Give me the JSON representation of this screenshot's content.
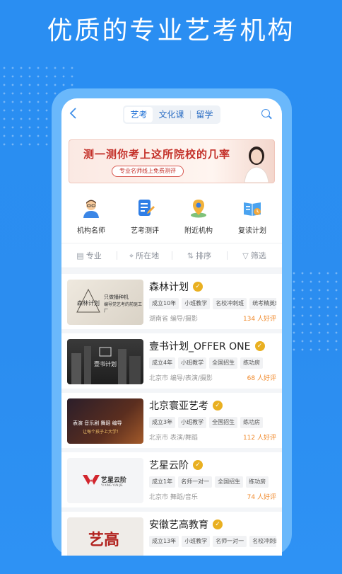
{
  "headline": "优质的专业艺考机构",
  "tabs": [
    {
      "label": "艺考",
      "active": true
    },
    {
      "label": "文化课",
      "active": false
    },
    {
      "label": "留学",
      "active": false
    }
  ],
  "banner": {
    "title": "测一测你考上这所院校的几率",
    "subtitle": "专业名师线上免费测评"
  },
  "categories": [
    {
      "label": "机构名师",
      "icon": "teacher-avatar-icon"
    },
    {
      "label": "艺考测评",
      "icon": "assessment-document-icon"
    },
    {
      "label": "附近机构",
      "icon": "nearby-map-pin-icon"
    },
    {
      "label": "复读计划",
      "icon": "reading-plan-book-icon"
    }
  ],
  "filters": [
    {
      "label": "专业",
      "icon": "major-icon"
    },
    {
      "label": "所在地",
      "icon": "location-icon"
    },
    {
      "label": "排序",
      "icon": "sort-icon"
    },
    {
      "label": "筛选",
      "icon": "filter-icon"
    }
  ],
  "institutions": [
    {
      "name": "森林计划",
      "tags": [
        "成立10年",
        "小班教学",
        "名校冲刺班",
        "统考精英班"
      ],
      "location": "湖南省 编导/摄影",
      "rating": "134 人好评",
      "thumb_text": [
        "森林计划",
        "只做播种机",
        "编导党艺考的前驱工厂"
      ]
    },
    {
      "name": "壹书计划_OFFER ONE",
      "tags": [
        "成立4年",
        "小班教学",
        "全国招生",
        "练功房"
      ],
      "location": "北京市 编导/表演/摄影",
      "rating": "68 人好评",
      "thumb_text": [
        "壹书计划"
      ]
    },
    {
      "name": "北京寰亚艺考",
      "tags": [
        "成立3年",
        "小班教学",
        "全国招生",
        "练功房"
      ],
      "location": "北京市 表演/舞蹈",
      "rating": "112 人好评",
      "thumb_text": [
        "表演 音乐剧 舞蹈 编导",
        "让每个孩子上大学！"
      ]
    },
    {
      "name": "艺星云阶",
      "tags": [
        "成立1年",
        "名师一对一",
        "全国招生",
        "练功房"
      ],
      "location": "北京市 舞蹈/音乐",
      "rating": "74 人好评",
      "thumb_text": [
        "艺星云阶",
        "YI XING YUN JIE"
      ]
    },
    {
      "name": "安徽艺高教育",
      "tags": [
        "成立13年",
        "小班教学",
        "名师一对一",
        "名校冲刺班"
      ],
      "location": "",
      "rating": "",
      "thumb_text": [
        "艺高"
      ]
    }
  ]
}
